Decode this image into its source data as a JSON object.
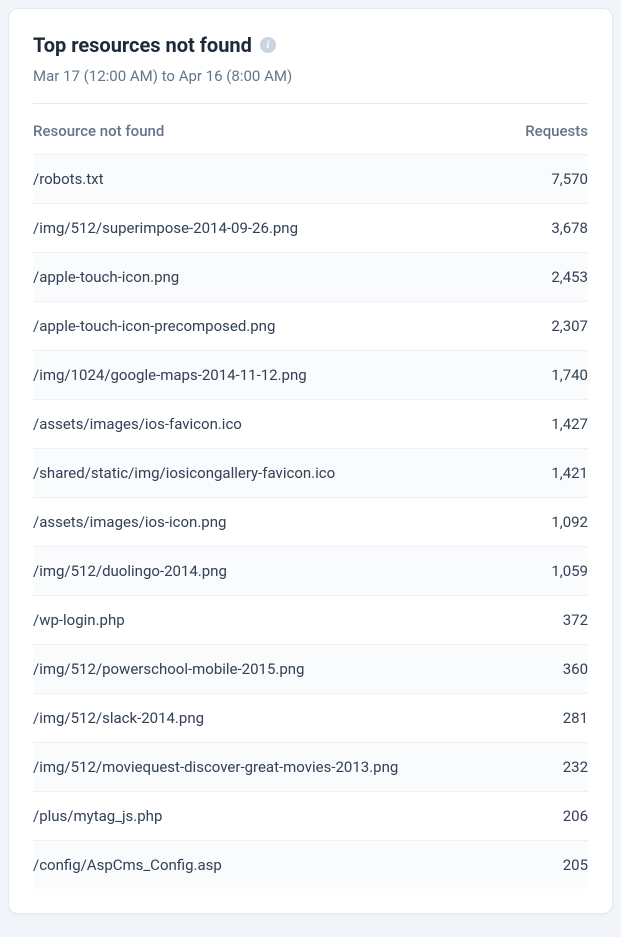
{
  "header": {
    "title": "Top resources not found",
    "info_glyph": "i",
    "date_range": "Mar 17 (12:00 AM) to Apr 16 (8:00 AM)"
  },
  "table": {
    "columns": {
      "resource": "Resource not found",
      "requests": "Requests"
    },
    "rows": [
      {
        "path": "/robots.txt",
        "requests": "7,570"
      },
      {
        "path": "/img/512/superimpose-2014-09-26.png",
        "requests": "3,678"
      },
      {
        "path": "/apple-touch-icon.png",
        "requests": "2,453"
      },
      {
        "path": "/apple-touch-icon-precomposed.png",
        "requests": "2,307"
      },
      {
        "path": "/img/1024/google-maps-2014-11-12.png",
        "requests": "1,740"
      },
      {
        "path": "/assets/images/ios-favicon.ico",
        "requests": "1,427"
      },
      {
        "path": "/shared/static/img/iosicongallery-favicon.ico",
        "requests": "1,421"
      },
      {
        "path": "/assets/images/ios-icon.png",
        "requests": "1,092"
      },
      {
        "path": "/img/512/duolingo-2014.png",
        "requests": "1,059"
      },
      {
        "path": "/wp-login.php",
        "requests": "372"
      },
      {
        "path": "/img/512/powerschool-mobile-2015.png",
        "requests": "360"
      },
      {
        "path": "/img/512/slack-2014.png",
        "requests": "281"
      },
      {
        "path": "/img/512/moviequest-discover-great-movies-2013.png",
        "requests": "232"
      },
      {
        "path": "/plus/mytag_js.php",
        "requests": "206"
      },
      {
        "path": "/config/AspCms_Config.asp",
        "requests": "205"
      }
    ]
  }
}
